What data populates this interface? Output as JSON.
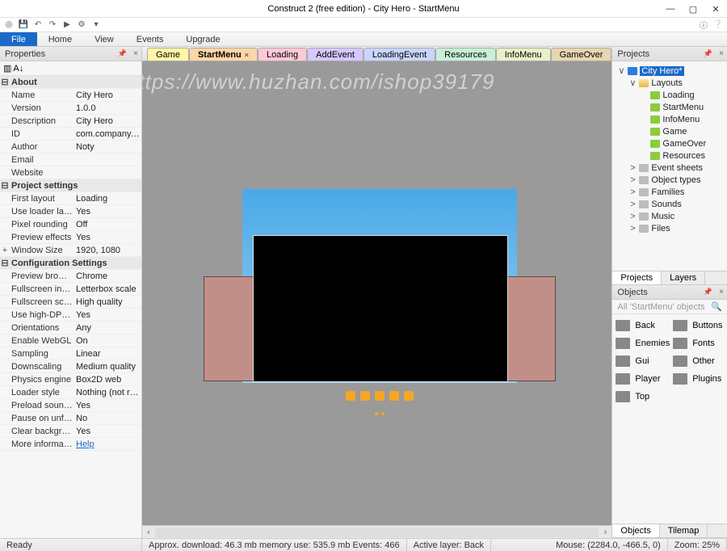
{
  "title": "Construct 2  (free edition) - City Hero - StartMenu",
  "window_controls": {
    "min": "—",
    "max": "▢",
    "close": "✕"
  },
  "menubar": [
    "File",
    "Home",
    "View",
    "Events",
    "Upgrade"
  ],
  "menubar_active_index": 0,
  "props_panel_title": "Properties",
  "properties": [
    {
      "section": "About"
    },
    {
      "k": "Name",
      "v": "City Hero"
    },
    {
      "k": "Version",
      "v": "1.0.0"
    },
    {
      "k": "Description",
      "v": "City Hero"
    },
    {
      "k": "ID",
      "v": "com.company.city…"
    },
    {
      "k": "Author",
      "v": "Noty"
    },
    {
      "k": "Email",
      "v": ""
    },
    {
      "k": "Website",
      "v": ""
    },
    {
      "section": "Project settings"
    },
    {
      "k": "First layout",
      "v": "Loading"
    },
    {
      "k": "Use loader lay…",
      "v": "Yes"
    },
    {
      "k": "Pixel rounding",
      "v": "Off"
    },
    {
      "k": "Preview effects",
      "v": "Yes"
    },
    {
      "k": "Window Size",
      "v": "1920, 1080",
      "toggle": "+"
    },
    {
      "section": "Configuration Settings"
    },
    {
      "k": "Preview browser",
      "v": "Chrome"
    },
    {
      "k": "Fullscreen in b…",
      "v": "Letterbox scale"
    },
    {
      "k": "Fullscreen scali…",
      "v": "High quality"
    },
    {
      "k": "Use high-DPI …",
      "v": "Yes"
    },
    {
      "k": "Orientations",
      "v": "Any"
    },
    {
      "k": "Enable WebGL",
      "v": "On"
    },
    {
      "k": "Sampling",
      "v": "Linear"
    },
    {
      "k": "Downscaling",
      "v": "Medium quality"
    },
    {
      "k": "Physics engine",
      "v": "Box2D web"
    },
    {
      "k": "Loader style",
      "v": "Nothing (not reco…"
    },
    {
      "k": "Preload sounds",
      "v": "Yes"
    },
    {
      "k": "Pause on unfo…",
      "v": "No"
    },
    {
      "k": "Clear backgro…",
      "v": "Yes"
    },
    {
      "k": "More information",
      "v": "Help",
      "link": true
    }
  ],
  "tabs": [
    {
      "label": "Game",
      "bg": "#fff6a8"
    },
    {
      "label": "StartMenu",
      "bg": "#ffd6a8",
      "closable": true,
      "active": true
    },
    {
      "label": "Loading",
      "bg": "#ffc8d6"
    },
    {
      "label": "AddEvent",
      "bg": "#d6c8ff"
    },
    {
      "label": "LoadingEvent",
      "bg": "#c8d6ff"
    },
    {
      "label": "Resources",
      "bg": "#c8f0d6"
    },
    {
      "label": "InfoMenu",
      "bg": "#e8f0c8"
    },
    {
      "label": "GameOver",
      "bg": "#e8d6b0"
    }
  ],
  "watermark": "https://www.huzhan.com/ishop39179",
  "projects_panel_title": "Projects",
  "project_tree": [
    {
      "depth": 0,
      "tw": "∨",
      "ic": "app",
      "label": "City Hero*",
      "sel": true
    },
    {
      "depth": 1,
      "tw": "∨",
      "ic": "fld-open",
      "label": "Layouts"
    },
    {
      "depth": 2,
      "tw": "",
      "ic": "layout",
      "label": "Loading"
    },
    {
      "depth": 2,
      "tw": "",
      "ic": "layout",
      "label": "StartMenu"
    },
    {
      "depth": 2,
      "tw": "",
      "ic": "layout",
      "label": "InfoMenu"
    },
    {
      "depth": 2,
      "tw": "",
      "ic": "layout",
      "label": "Game"
    },
    {
      "depth": 2,
      "tw": "",
      "ic": "layout",
      "label": "GameOver"
    },
    {
      "depth": 2,
      "tw": "",
      "ic": "layout",
      "label": "Resources"
    },
    {
      "depth": 1,
      "tw": ">",
      "ic": "fld",
      "label": "Event sheets"
    },
    {
      "depth": 1,
      "tw": ">",
      "ic": "fld",
      "label": "Object types"
    },
    {
      "depth": 1,
      "tw": ">",
      "ic": "fld",
      "label": "Families"
    },
    {
      "depth": 1,
      "tw": ">",
      "ic": "fld",
      "label": "Sounds"
    },
    {
      "depth": 1,
      "tw": ">",
      "ic": "fld",
      "label": "Music"
    },
    {
      "depth": 1,
      "tw": ">",
      "ic": "fld",
      "label": "Files"
    }
  ],
  "side_tabs_top": [
    "Projects",
    "Layers"
  ],
  "objects_panel_title": "Objects",
  "objects_filter_placeholder": "All 'StartMenu' objects",
  "objects": [
    "Back",
    "Buttons",
    "Enemies",
    "Fonts",
    "Gui",
    "Other",
    "Player",
    "Plugins",
    "Top"
  ],
  "side_tabs_bottom": [
    "Objects",
    "Tilemap"
  ],
  "status": {
    "ready": "Ready",
    "stats": "Approx. download: 46.3 mb   memory use: 535.9 mb   Events: 466",
    "layer": "Active layer: Back",
    "mouse": "Mouse: (2284.0, -466.5, 0)",
    "zoom": "Zoom: 25%"
  }
}
